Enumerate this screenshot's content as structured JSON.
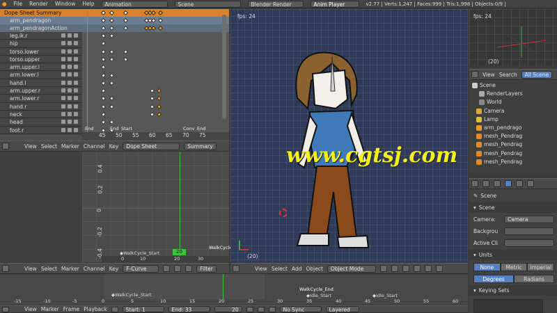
{
  "topbar": {
    "menus": [
      "File",
      "Render",
      "Window",
      "Help"
    ],
    "layout": "Animation",
    "scene": "Scene",
    "engine": "Blender Render",
    "player": "Anim Player",
    "stats": "v2.77 | Verts:1,247 | Faces:999 | Tris:1,998 | Objects:0/9 |"
  },
  "dopesheet": {
    "summary": "Dope Sheet Summary",
    "object": "arm_pendragon",
    "action": "arm_pendragonAction",
    "channels": [
      "leg.ik.r",
      "hip",
      "torso.lower",
      "torso.upper",
      "arm.upper.l",
      "arm.lower.l",
      "hand.l",
      "arm.upper.r",
      "arm.lower.r",
      "hand.r",
      "neck",
      "head",
      "foot.r"
    ],
    "ticks": [
      "45",
      "50",
      "55",
      "60",
      "65",
      "70",
      "75"
    ],
    "markers": [
      "End",
      "End",
      "Start",
      "Conv",
      "End"
    ],
    "header": {
      "view": "View",
      "select": "Select",
      "marker": "Marker",
      "channel": "Channel",
      "key": "Key",
      "mode": "Dope Sheet",
      "summary": "Summary"
    }
  },
  "fcurve": {
    "yticks": [
      "0.4",
      "0.2",
      "0",
      "-0.2",
      "-0.4"
    ],
    "xticks": [
      "0",
      "10",
      "20",
      "30"
    ],
    "frame": "20",
    "marker1": "WalkCycle_Start",
    "marker2": "WalkCycle",
    "header": {
      "view": "View",
      "select": "Select",
      "marker": "Marker",
      "channel": "Channel",
      "key": "Key",
      "mode": "F-Curve",
      "filter": "Filter"
    }
  },
  "viewport": {
    "fps": "fps: 24",
    "frame": "(20)",
    "watermark": "www.cgtsj.com",
    "header": {
      "view": "View",
      "select": "Select",
      "add": "Add",
      "object": "Object",
      "mode": "Object Mode"
    }
  },
  "camview": {
    "fps": "fps: 24",
    "frame": "(20)"
  },
  "outliner": {
    "view": "View",
    "search": "Search",
    "all": "All Scene",
    "items": [
      "Scene",
      "RenderLayers",
      "World",
      "Camera",
      "Lamp",
      "arm_pendrago",
      "mesh_Pendrag",
      "mesh_Pendrag",
      "mesh_Pendrag",
      "mesh_Pendrag"
    ]
  },
  "props": {
    "scene_panel": "Scene",
    "scene_name": "Scene",
    "camera_label": "Camera:",
    "camera_value": "Camera",
    "background_label": "Backgrou",
    "active_clip_label": "Active Cli",
    "units_panel": "Units",
    "unit_none": "None",
    "unit_metric": "Metric",
    "unit_imperial": "Imperial",
    "deg": "Degrees",
    "rad": "Radians",
    "keying": "Keying Sets"
  },
  "timeline": {
    "ticks": [
      "-15",
      "-10",
      "-5",
      "0",
      "5",
      "10",
      "15",
      "20",
      "25",
      "30",
      "35",
      "40",
      "45",
      "50",
      "55",
      "60"
    ],
    "markers": [
      "WalkCycle_Start",
      "WalkCycle_End",
      "Idle_Start",
      "Idle_Start"
    ],
    "header": {
      "view": "View",
      "marker": "Marker",
      "frame": "Frame",
      "playback": "Playback",
      "start": "Start:",
      "start_val": "1",
      "end": "End:",
      "end_val": "33",
      "current": "20",
      "sync": "No Sync",
      "layered": "Layered"
    }
  },
  "colors": {
    "accent": "#f3a32a",
    "selected": "#5680c2",
    "frame": "#3ec23e"
  }
}
